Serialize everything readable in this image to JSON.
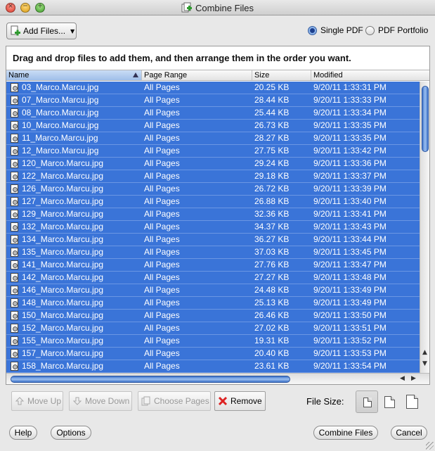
{
  "window": {
    "title": "Combine Files"
  },
  "toolbar": {
    "add_files_label": "Add Files...",
    "single_pdf_label": "Single PDF",
    "pdf_portfolio_label": "PDF Portfolio",
    "selected_mode": "Single PDF"
  },
  "instructions": "Drag and drop files to add them, and then arrange them in the order you want.",
  "table": {
    "columns": [
      "Name",
      "Page Range",
      "Size",
      "Modified"
    ],
    "sorted_column": "Name",
    "rows": [
      {
        "name": "03_Marco.Marcu.jpg",
        "page_range": "All Pages",
        "size": "20.25 KB",
        "modified": "9/20/11 1:33:31 PM"
      },
      {
        "name": "07_Marco.Marcu.jpg",
        "page_range": "All Pages",
        "size": "28.44 KB",
        "modified": "9/20/11 1:33:33 PM"
      },
      {
        "name": "08_Marco.Marcu.jpg",
        "page_range": "All Pages",
        "size": "25.44 KB",
        "modified": "9/20/11 1:33:34 PM"
      },
      {
        "name": "10_Marco.Marcu.jpg",
        "page_range": "All Pages",
        "size": "26.73 KB",
        "modified": "9/20/11 1:33:35 PM"
      },
      {
        "name": "11_Marco.Marcu.jpg",
        "page_range": "All Pages",
        "size": "28.27 KB",
        "modified": "9/20/11 1:33:35 PM"
      },
      {
        "name": "12_Marco.Marcu.jpg",
        "page_range": "All Pages",
        "size": "27.75 KB",
        "modified": "9/20/11 1:33:42 PM"
      },
      {
        "name": "120_Marco.Marcu.jpg",
        "page_range": "All Pages",
        "size": "29.24 KB",
        "modified": "9/20/11 1:33:36 PM"
      },
      {
        "name": "122_Marco.Marcu.jpg",
        "page_range": "All Pages",
        "size": "29.18 KB",
        "modified": "9/20/11 1:33:37 PM"
      },
      {
        "name": "126_Marco.Marcu.jpg",
        "page_range": "All Pages",
        "size": "26.72 KB",
        "modified": "9/20/11 1:33:39 PM"
      },
      {
        "name": "127_Marco.Marcu.jpg",
        "page_range": "All Pages",
        "size": "26.88 KB",
        "modified": "9/20/11 1:33:40 PM"
      },
      {
        "name": "129_Marco.Marcu.jpg",
        "page_range": "All Pages",
        "size": "32.36 KB",
        "modified": "9/20/11 1:33:41 PM"
      },
      {
        "name": "132_Marco.Marcu.jpg",
        "page_range": "All Pages",
        "size": "34.37 KB",
        "modified": "9/20/11 1:33:43 PM"
      },
      {
        "name": "134_Marco.Marcu.jpg",
        "page_range": "All Pages",
        "size": "36.27 KB",
        "modified": "9/20/11 1:33:44 PM"
      },
      {
        "name": "135_Marco.Marcu.jpg",
        "page_range": "All Pages",
        "size": "37.03 KB",
        "modified": "9/20/11 1:33:45 PM"
      },
      {
        "name": "141_Marco.Marcu.jpg",
        "page_range": "All Pages",
        "size": "27.76 KB",
        "modified": "9/20/11 1:33:47 PM"
      },
      {
        "name": "142_Marco.Marcu.jpg",
        "page_range": "All Pages",
        "size": "27.27 KB",
        "modified": "9/20/11 1:33:48 PM"
      },
      {
        "name": "146_Marco.Marcu.jpg",
        "page_range": "All Pages",
        "size": "24.48 KB",
        "modified": "9/20/11 1:33:49 PM"
      },
      {
        "name": "148_Marco.Marcu.jpg",
        "page_range": "All Pages",
        "size": "25.13 KB",
        "modified": "9/20/11 1:33:49 PM"
      },
      {
        "name": "150_Marco.Marcu.jpg",
        "page_range": "All Pages",
        "size": "26.46 KB",
        "modified": "9/20/11 1:33:50 PM"
      },
      {
        "name": "152_Marco.Marcu.jpg",
        "page_range": "All Pages",
        "size": "27.02 KB",
        "modified": "9/20/11 1:33:51 PM"
      },
      {
        "name": "155_Marco.Marcu.jpg",
        "page_range": "All Pages",
        "size": "19.31 KB",
        "modified": "9/20/11 1:33:52 PM"
      },
      {
        "name": "157_Marco.Marcu.jpg",
        "page_range": "All Pages",
        "size": "20.40 KB",
        "modified": "9/20/11 1:33:53 PM"
      },
      {
        "name": "158_Marco.Marcu.jpg",
        "page_range": "All Pages",
        "size": "23.61 KB",
        "modified": "9/20/11 1:33:54 PM"
      }
    ]
  },
  "actions": {
    "move_up": "Move Up",
    "move_down": "Move Down",
    "choose_pages": "Choose Pages",
    "remove": "Remove"
  },
  "file_size": {
    "label": "File Size:",
    "selected": "smallest"
  },
  "footer": {
    "help": "Help",
    "options": "Options",
    "combine": "Combine Files",
    "cancel": "Cancel"
  },
  "colors": {
    "selection": "#3a74d8",
    "accent": "#2a55a0"
  }
}
